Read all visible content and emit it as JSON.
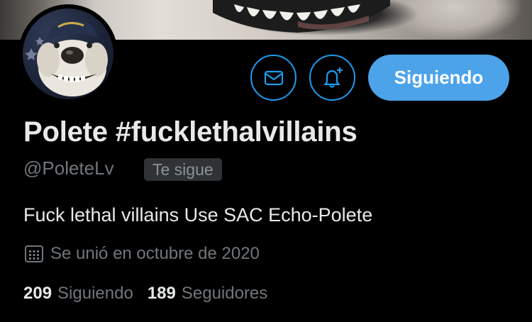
{
  "profile": {
    "display_name": "Polete #fucklethalvillains",
    "handle": "@PoleteLv",
    "follows_you_badge": "Te sigue",
    "bio": "Fuck lethal villains Use SAC Echo-Polete",
    "joined": "Se unió en octubre de 2020",
    "following_count": "209",
    "following_label": "Siguiendo",
    "followers_count": "189",
    "followers_label": "Seguidores"
  },
  "actions": {
    "message_icon": "mail-icon",
    "notify_icon": "bell-plus-icon",
    "follow_button_label": "Siguiendo"
  },
  "colors": {
    "accent": "#1d9bf0",
    "follow_button_bg": "#4ca3ea",
    "background": "#000000",
    "secondary_text": "#71767b"
  }
}
